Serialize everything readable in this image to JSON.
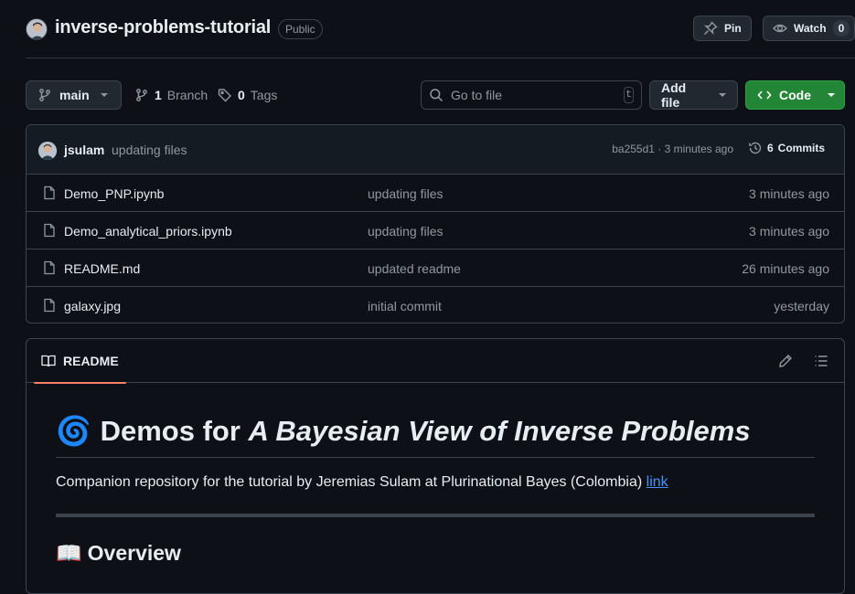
{
  "repo": {
    "name": "inverse-problems-tutorial",
    "visibility": "Public",
    "pin_label": "Pin",
    "watch_label": "Watch",
    "watch_count": "0"
  },
  "toolbar": {
    "branch": "main",
    "branches_count": "1",
    "branches_label": "Branch",
    "tags_count": "0",
    "tags_label": "Tags",
    "search_placeholder": "Go to file",
    "search_shortcut": "t",
    "add_file_label": "Add file",
    "code_label": "Code"
  },
  "latest_commit": {
    "author": "jsulam",
    "message": "updating files",
    "meta": "ba255d1 · 3 minutes ago",
    "commits_count": "6",
    "commits_label": "Commits"
  },
  "files": [
    {
      "name": "Demo_PNP.ipynb",
      "commit": "updating files",
      "time": "3 minutes ago"
    },
    {
      "name": "Demo_analytical_priors.ipynb",
      "commit": "updating files",
      "time": "3 minutes ago"
    },
    {
      "name": "README.md",
      "commit": "updated readme",
      "time": "26 minutes ago"
    },
    {
      "name": "galaxy.jpg",
      "commit": "initial commit",
      "time": "yesterday"
    }
  ],
  "readme": {
    "tab_label": "README",
    "h1_emoji": "🌀",
    "h1_prefix": "Demos for",
    "h1_italic": "A Bayesian View of Inverse Problems",
    "intro_text": "Companion repository for the tutorial by Jeremias Sulam at Plurinational Bayes (Colombia)",
    "intro_link": "link",
    "h2_emoji": "📖",
    "h2_text": "Overview"
  },
  "colors": {
    "background": "#0d1117",
    "border": "#3d444d",
    "accent_green": "#238636",
    "link_blue": "#4493f8",
    "tab_underline": "#f78166"
  }
}
